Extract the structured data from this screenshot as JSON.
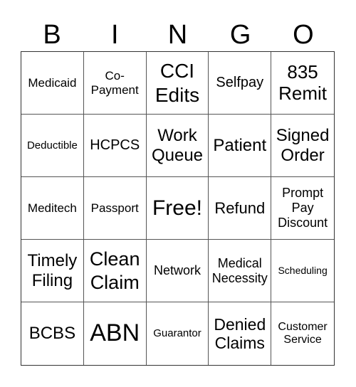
{
  "header": {
    "letters": [
      "B",
      "I",
      "N",
      "G",
      "O"
    ]
  },
  "card": {
    "rows": [
      [
        "Medicaid",
        "Co-\nPayment",
        "CCI\nEdits",
        "Selfpay",
        "835\nRemit"
      ],
      [
        "Deductible",
        "HCPCS",
        "Work\nQueue",
        "Patient",
        "Signed\nOrder"
      ],
      [
        "Meditech",
        "Passport",
        "Free!",
        "Refund",
        "Prompt\nPay\nDiscount"
      ],
      [
        "Timely\nFiling",
        "Clean\nClaim",
        "Network",
        "Medical\nNecessity",
        "Scheduling"
      ],
      [
        "BCBS",
        "ABN",
        "Guarantor",
        "Denied\nClaims",
        "Customer\nService"
      ]
    ],
    "free_space": "Free!"
  }
}
